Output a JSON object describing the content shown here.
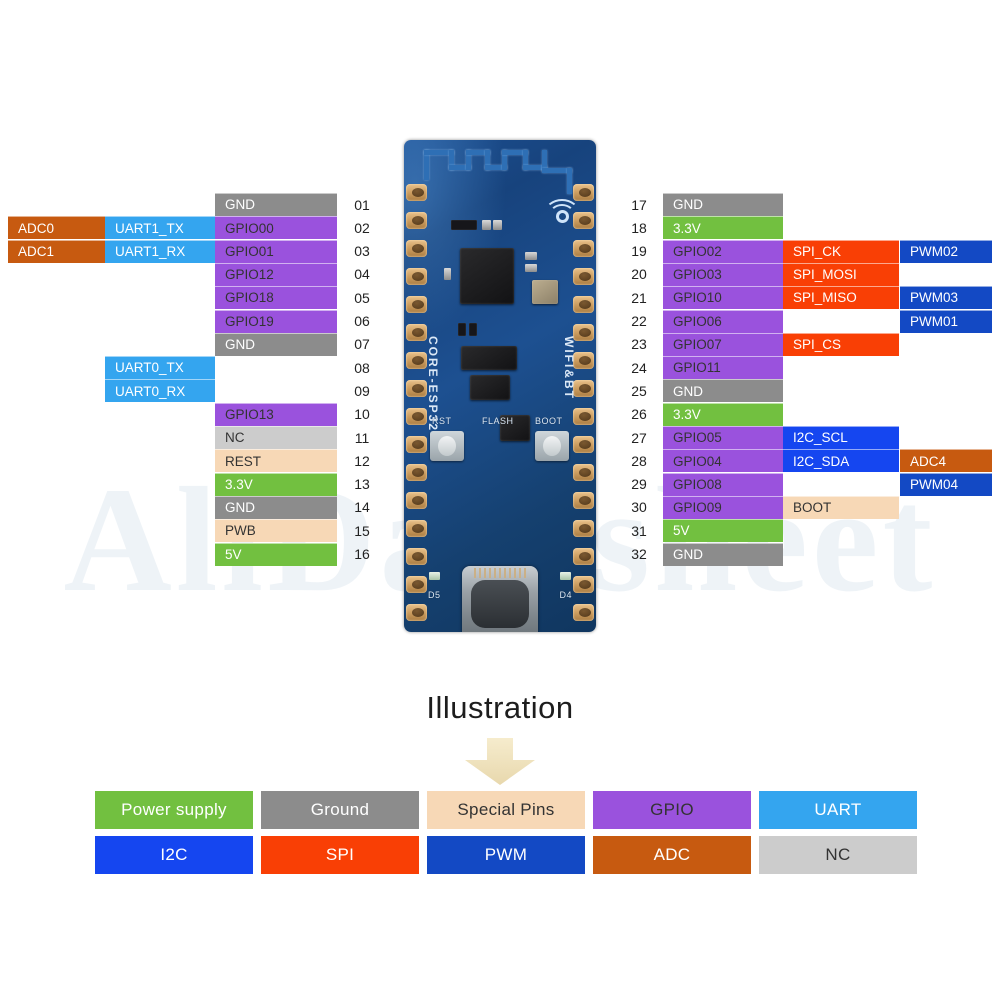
{
  "title_text": "Illustration",
  "watermark": "AllDatasheet",
  "palette": {
    "power": "#72c040",
    "ground": "#8c8c8c",
    "special": "#f7d8b6",
    "gpio": "#9a52dd",
    "uart": "#34a5ef",
    "i2c": "#1546f0",
    "spi": "#f93f05",
    "pwm": "#1349c4",
    "adc": "#c75a10",
    "nc": "#cccccc",
    "text_light": "#ffffff",
    "text_dark": "#333333"
  },
  "board": {
    "silk_left": "CORE-ESP32",
    "silk_right": "WIFI&BT",
    "button_rst": "RST",
    "button_flash": "FLASH",
    "button_boot": "BOOT",
    "led_left": "D5",
    "led_right": "D4"
  },
  "left_column": {
    "pin_numbers": [
      "01",
      "02",
      "03",
      "04",
      "05",
      "06",
      "07",
      "08",
      "09",
      "10",
      "11",
      "12",
      "13",
      "14",
      "15",
      "16"
    ],
    "rows": [
      {
        "num": "01",
        "primary": {
          "label": "GND",
          "type": "ground"
        },
        "alts": []
      },
      {
        "num": "02",
        "primary": {
          "label": "GPIO00",
          "type": "gpio"
        },
        "alts": [
          {
            "label": "UART1_TX",
            "type": "uart"
          },
          {
            "label": "ADC0",
            "type": "adc"
          }
        ]
      },
      {
        "num": "03",
        "primary": {
          "label": "GPIO01",
          "type": "gpio"
        },
        "alts": [
          {
            "label": "UART1_RX",
            "type": "uart"
          },
          {
            "label": "ADC1",
            "type": "adc"
          }
        ]
      },
      {
        "num": "04",
        "primary": {
          "label": "GPIO12",
          "type": "gpio"
        },
        "alts": []
      },
      {
        "num": "05",
        "primary": {
          "label": "GPIO18",
          "type": "gpio"
        },
        "alts": []
      },
      {
        "num": "06",
        "primary": {
          "label": "GPIO19",
          "type": "gpio"
        },
        "alts": []
      },
      {
        "num": "07",
        "primary": {
          "label": "GND",
          "type": "ground"
        },
        "alts": []
      },
      {
        "num": "08",
        "primary": {
          "label": "",
          "type": "none"
        },
        "alts": [
          {
            "label": "UART0_TX",
            "type": "uart"
          }
        ]
      },
      {
        "num": "09",
        "primary": {
          "label": "",
          "type": "none"
        },
        "alts": [
          {
            "label": "UART0_RX",
            "type": "uart"
          }
        ]
      },
      {
        "num": "10",
        "primary": {
          "label": "GPIO13",
          "type": "gpio"
        },
        "alts": []
      },
      {
        "num": "11",
        "primary": {
          "label": "NC",
          "type": "nc"
        },
        "alts": []
      },
      {
        "num": "12",
        "primary": {
          "label": "REST",
          "type": "special"
        },
        "alts": []
      },
      {
        "num": "13",
        "primary": {
          "label": "3.3V",
          "type": "power"
        },
        "alts": []
      },
      {
        "num": "14",
        "primary": {
          "label": "GND",
          "type": "ground"
        },
        "alts": []
      },
      {
        "num": "15",
        "primary": {
          "label": "PWB",
          "type": "special"
        },
        "alts": []
      },
      {
        "num": "16",
        "primary": {
          "label": "5V",
          "type": "power"
        },
        "alts": []
      }
    ]
  },
  "right_column": {
    "pin_numbers": [
      "17",
      "18",
      "19",
      "20",
      "21",
      "22",
      "23",
      "24",
      "25",
      "26",
      "27",
      "28",
      "29",
      "30",
      "31",
      "32"
    ],
    "rows": [
      {
        "num": "17",
        "primary": {
          "label": "GND",
          "type": "ground"
        },
        "alt1": null,
        "alt2": null
      },
      {
        "num": "18",
        "primary": {
          "label": "3.3V",
          "type": "power"
        },
        "alt1": null,
        "alt2": null
      },
      {
        "num": "19",
        "primary": {
          "label": "GPIO02",
          "type": "gpio"
        },
        "alt1": {
          "label": "SPI_CK",
          "type": "spi"
        },
        "alt2": {
          "label": "PWM02",
          "type": "pwm"
        }
      },
      {
        "num": "20",
        "primary": {
          "label": "GPIO03",
          "type": "gpio"
        },
        "alt1": {
          "label": "SPI_MOSI",
          "type": "spi"
        },
        "alt2": null
      },
      {
        "num": "21",
        "primary": {
          "label": "GPIO10",
          "type": "gpio"
        },
        "alt1": {
          "label": "SPI_MISO",
          "type": "spi"
        },
        "alt2": {
          "label": "PWM03",
          "type": "pwm"
        }
      },
      {
        "num": "22",
        "primary": {
          "label": "GPIO06",
          "type": "gpio"
        },
        "alt1": null,
        "alt2": {
          "label": "PWM01",
          "type": "pwm"
        }
      },
      {
        "num": "23",
        "primary": {
          "label": "GPIO07",
          "type": "gpio"
        },
        "alt1": {
          "label": "SPI_CS",
          "type": "spi"
        },
        "alt2": null
      },
      {
        "num": "24",
        "primary": {
          "label": "GPIO11",
          "type": "gpio"
        },
        "alt1": null,
        "alt2": null
      },
      {
        "num": "25",
        "primary": {
          "label": "GND",
          "type": "ground"
        },
        "alt1": null,
        "alt2": null
      },
      {
        "num": "26",
        "primary": {
          "label": "3.3V",
          "type": "power"
        },
        "alt1": null,
        "alt2": null
      },
      {
        "num": "27",
        "primary": {
          "label": "GPIO05",
          "type": "gpio"
        },
        "alt1": {
          "label": "I2C_SCL",
          "type": "i2c"
        },
        "alt2": null
      },
      {
        "num": "28",
        "primary": {
          "label": "GPIO04",
          "type": "gpio"
        },
        "alt1": {
          "label": "I2C_SDA",
          "type": "i2c"
        },
        "alt2": {
          "label": "ADC4",
          "type": "adc"
        }
      },
      {
        "num": "29",
        "primary": {
          "label": "GPIO08",
          "type": "gpio"
        },
        "alt1": null,
        "alt2": {
          "label": "PWM04",
          "type": "pwm"
        }
      },
      {
        "num": "30",
        "primary": {
          "label": "GPIO09",
          "type": "gpio"
        },
        "alt1": {
          "label": "BOOT",
          "type": "special"
        },
        "alt2": null
      },
      {
        "num": "31",
        "primary": {
          "label": "5V",
          "type": "power"
        },
        "alt1": null,
        "alt2": null
      },
      {
        "num": "32",
        "primary": {
          "label": "GND",
          "type": "ground"
        },
        "alt1": null,
        "alt2": null
      }
    ]
  },
  "legend": {
    "rows": [
      [
        {
          "label": "Power supply",
          "type": "power"
        },
        {
          "label": "Ground",
          "type": "ground"
        },
        {
          "label": "Special Pins",
          "type": "special"
        },
        {
          "label": "GPIO",
          "type": "gpio"
        },
        {
          "label": "UART",
          "type": "uart"
        }
      ],
      [
        {
          "label": "I2C",
          "type": "i2c"
        },
        {
          "label": "SPI",
          "type": "spi"
        },
        {
          "label": "PWM",
          "type": "pwm"
        },
        {
          "label": "ADC",
          "type": "adc"
        },
        {
          "label": "NC",
          "type": "nc"
        }
      ]
    ]
  }
}
